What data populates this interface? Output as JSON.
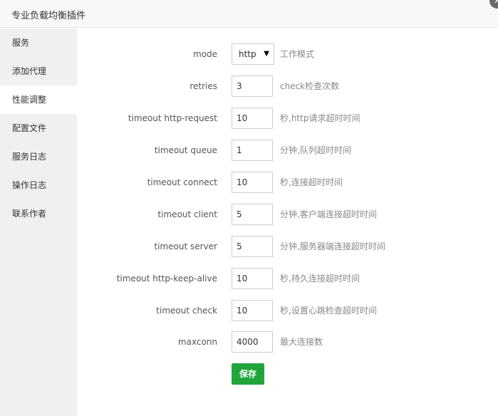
{
  "dialog": {
    "title": "专业负载均衡插件",
    "close_icon": "close-icon"
  },
  "sidebar": {
    "items": [
      {
        "label": "服务",
        "active": false
      },
      {
        "label": "添加代理",
        "active": false
      },
      {
        "label": "性能调整",
        "active": true
      },
      {
        "label": "配置文件",
        "active": false
      },
      {
        "label": "服务日志",
        "active": false
      },
      {
        "label": "操作日志",
        "active": false
      },
      {
        "label": "联系作者",
        "active": false
      }
    ]
  },
  "form": {
    "rows": [
      {
        "label": "mode",
        "value": "http",
        "hint": "工作模式",
        "type": "select"
      },
      {
        "label": "retries",
        "value": "3",
        "hint": "check检查次数"
      },
      {
        "label": "timeout http-request",
        "value": "10",
        "hint": "秒,http请求超时时间"
      },
      {
        "label": "timeout queue",
        "value": "1",
        "hint": "分钟,队列超时时间"
      },
      {
        "label": "timeout connect",
        "value": "10",
        "hint": "秒,连接超时时间"
      },
      {
        "label": "timeout client",
        "value": "5",
        "hint": "分钟,客户端连接超时时间"
      },
      {
        "label": "timeout server",
        "value": "5",
        "hint": "分钟,服务器端连接超时时间"
      },
      {
        "label": "timeout http-keep-alive",
        "value": "10",
        "hint": "秒,持久连接超时时间"
      },
      {
        "label": "timeout check",
        "value": "10",
        "hint": "秒,设置心跳检查超时时间"
      },
      {
        "label": "maxconn",
        "value": "4000",
        "hint": "最大连接数"
      }
    ],
    "save_label": "保存"
  },
  "colors": {
    "accent": "#20a53a",
    "sidebar_bg": "#f0f0f0"
  }
}
